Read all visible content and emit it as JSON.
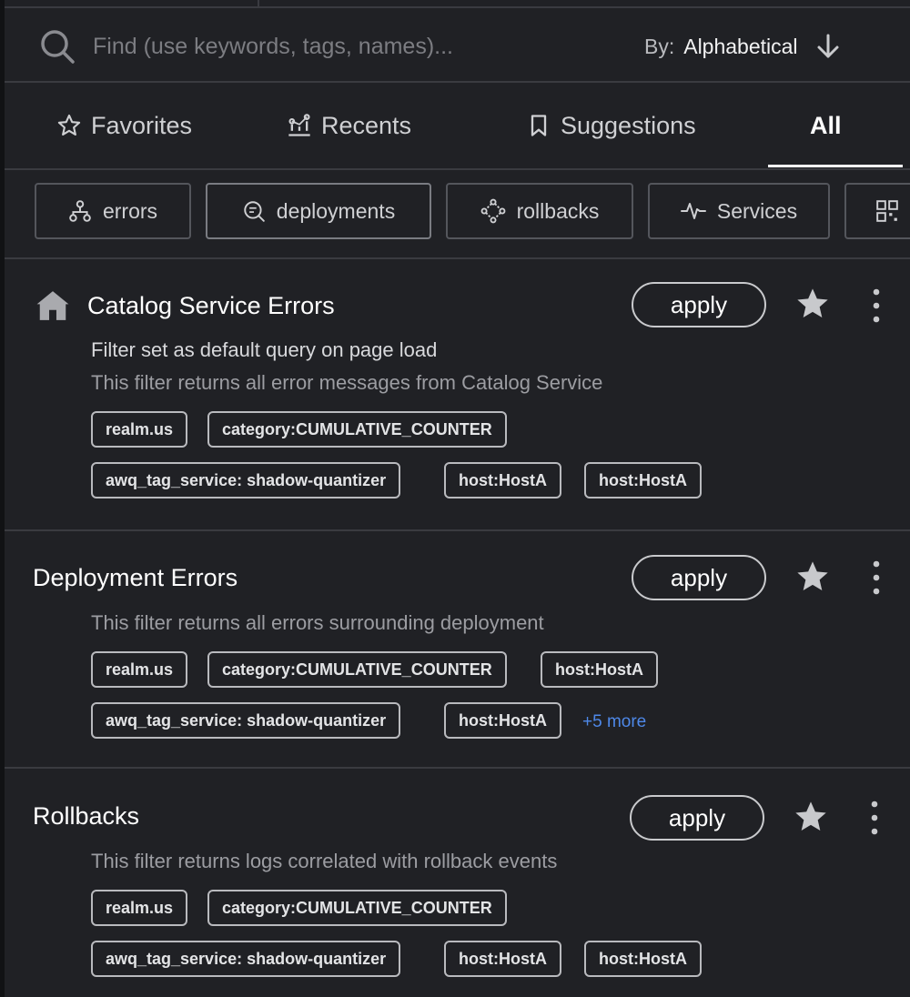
{
  "search": {
    "placeholder": "Find (use keywords, tags, names)...",
    "sort_prefix": "By:",
    "sort_value": "Alphabetical",
    "icon": "search-icon",
    "sort_icon": "arrow-down-icon"
  },
  "tabs": [
    {
      "label": "Favorites",
      "icon": "star-outline-icon",
      "active": false
    },
    {
      "label": "Recents",
      "icon": "recents-icon",
      "active": false
    },
    {
      "label": "Suggestions",
      "icon": "bookmark-icon",
      "active": false
    },
    {
      "label": "All",
      "icon": "",
      "active": true
    }
  ],
  "chips": [
    {
      "label": "errors",
      "icon": "hierarchy-icon"
    },
    {
      "label": "deployments",
      "icon": "search-list-icon"
    },
    {
      "label": "rollbacks",
      "icon": "nodes-icon"
    },
    {
      "label": "Services",
      "icon": "pulse-icon"
    },
    {
      "label": "",
      "icon": "grid-qr-icon"
    }
  ],
  "filters": [
    {
      "title": "Catalog Service Errors",
      "is_default": true,
      "icon": "home-icon",
      "default_note": "Filter set as default query on page load",
      "description": "This filter returns all error messages from Catalog Service",
      "apply_label": "apply",
      "favorite": true,
      "tags": [
        "realm.us",
        "category:CUMULATIVE_COUNTER",
        "awq_tag_service: shadow-quantizer",
        "host:HostA",
        "host:HostA"
      ],
      "more_link": ""
    },
    {
      "title": "Deployment Errors",
      "is_default": false,
      "description": "This filter returns all errors surrounding  deployment",
      "apply_label": "apply",
      "favorite": true,
      "tags": [
        "realm.us",
        "category:CUMULATIVE_COUNTER",
        "host:HostA",
        "awq_tag_service: shadow-quantizer",
        "host:HostA"
      ],
      "more_link": "+5 more"
    },
    {
      "title": "Rollbacks",
      "is_default": false,
      "description": "This filter returns logs correlated with rollback events",
      "apply_label": "apply",
      "favorite": true,
      "tags": [
        "realm.us",
        "category:CUMULATIVE_COUNTER",
        "awq_tag_service: shadow-quantizer",
        "host:HostA",
        "host:HostA"
      ],
      "more_link": ""
    }
  ],
  "colors": {
    "background": "#202125",
    "divider": "#3a3b40",
    "text": "#f2f2f3",
    "muted": "#9c9da2",
    "link": "#4e88e8",
    "star": "#c8c9cc"
  }
}
